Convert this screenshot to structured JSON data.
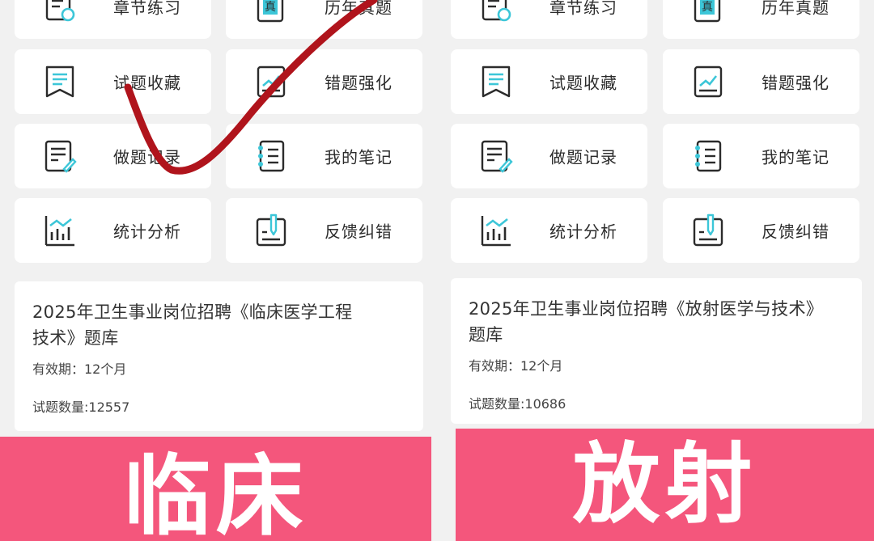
{
  "left": {
    "tiles": [
      {
        "label": "章节练习",
        "icon": "chapter-practice-icon"
      },
      {
        "label": "历年真题",
        "icon": "past-exams-icon"
      },
      {
        "label": "试题收藏",
        "icon": "favorites-icon"
      },
      {
        "label": "错题强化",
        "icon": "mistakes-icon"
      },
      {
        "label": "做题记录",
        "icon": "record-icon"
      },
      {
        "label": "我的笔记",
        "icon": "notes-icon"
      },
      {
        "label": "统计分析",
        "icon": "statistics-icon"
      },
      {
        "label": "反馈纠错",
        "icon": "feedback-icon"
      }
    ],
    "card": {
      "title": "2025年卫生事业岗位招聘《临床医学工程技术》题库",
      "validity": "有效期：12个月",
      "count": "试题数量:12557"
    },
    "banner": "临床"
  },
  "right": {
    "tiles": [
      {
        "label": "章节练习",
        "icon": "chapter-practice-icon"
      },
      {
        "label": "历年真题",
        "icon": "past-exams-icon"
      },
      {
        "label": "试题收藏",
        "icon": "favorites-icon"
      },
      {
        "label": "错题强化",
        "icon": "mistakes-icon"
      },
      {
        "label": "做题记录",
        "icon": "record-icon"
      },
      {
        "label": "我的笔记",
        "icon": "notes-icon"
      },
      {
        "label": "统计分析",
        "icon": "statistics-icon"
      },
      {
        "label": "反馈纠错",
        "icon": "feedback-icon"
      }
    ],
    "card": {
      "title": "2025年卫生事业岗位招聘《放射医学与技术》题库",
      "validity": "有效期：12个月",
      "count": "试题数量:10686"
    },
    "banner": "放射"
  },
  "colors": {
    "banner": "#f4567c",
    "icon_accent": "#3cc6d8",
    "checkmark": "#b0141c"
  }
}
